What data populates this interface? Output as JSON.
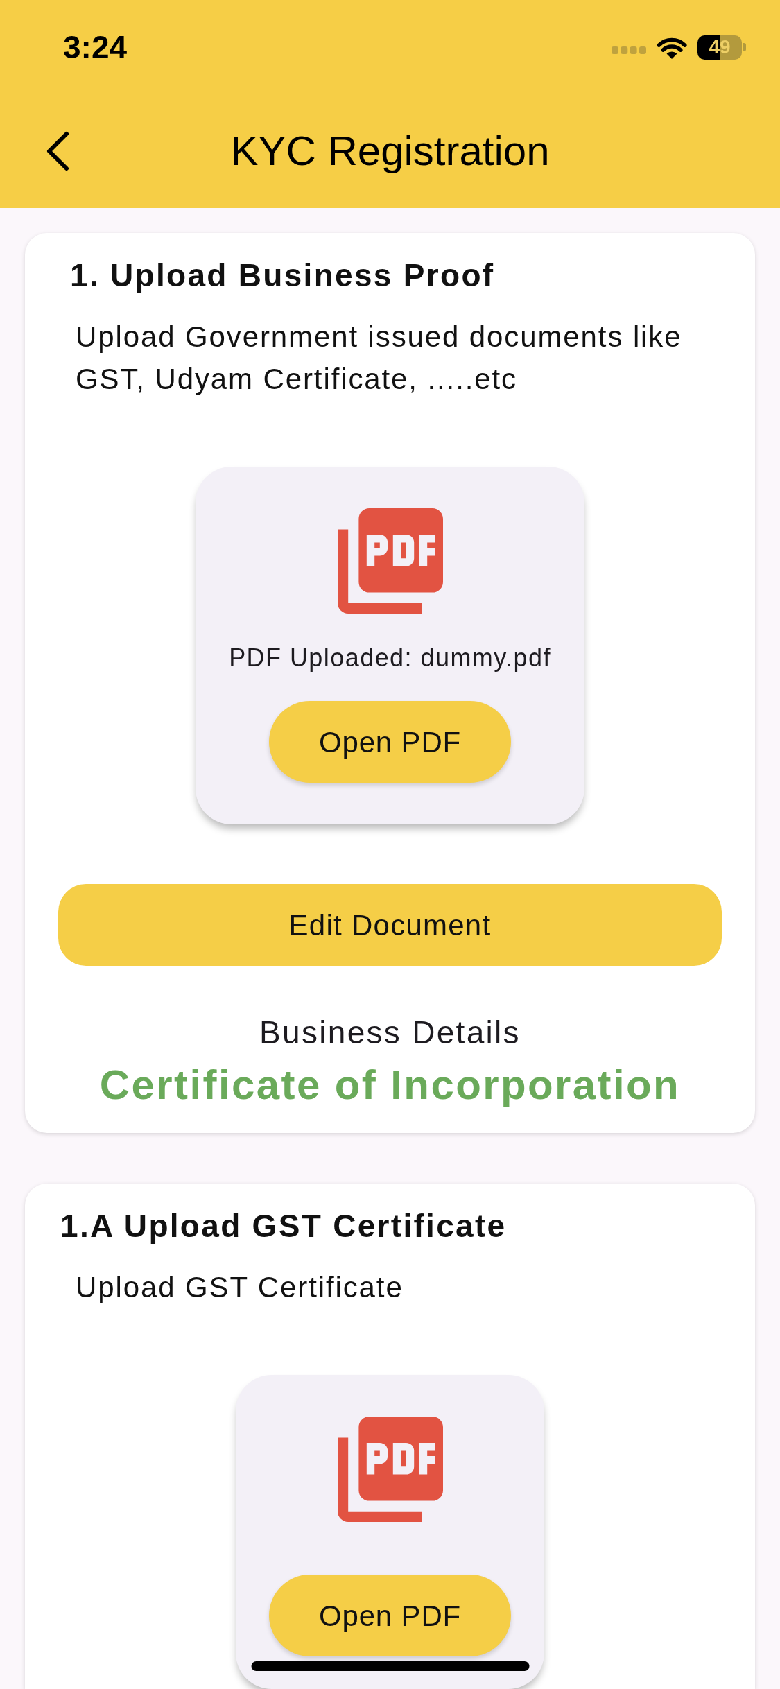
{
  "status_bar": {
    "time": "3:24",
    "battery": "49"
  },
  "header": {
    "title": "KYC Registration"
  },
  "sections": [
    {
      "title": "1. Upload Business Proof",
      "description": "Upload Government issued documents like GST, Udyam Certificate, .....etc",
      "upload": {
        "status": "PDF Uploaded: dummy.pdf",
        "button": "Open PDF"
      },
      "edit_button": "Edit Document",
      "details": {
        "label": "Business Details",
        "value": "Certificate of Incorporation"
      }
    },
    {
      "title": "1.A Upload GST Certificate",
      "description": "Upload GST Certificate",
      "upload": {
        "button": "Open PDF"
      }
    }
  ]
}
